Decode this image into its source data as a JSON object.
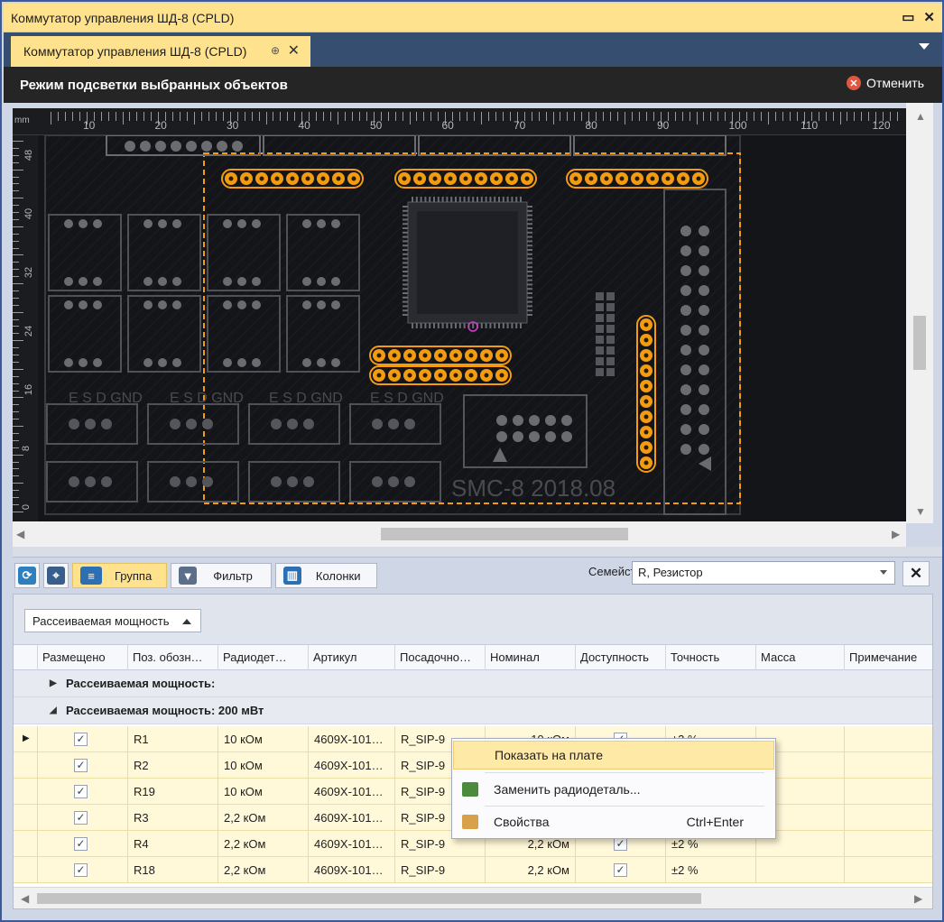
{
  "window": {
    "title": "Коммутатор управления ШД-8 (CPLD)",
    "restore_glyph": "▭",
    "close_glyph": "✕"
  },
  "tab": {
    "label": "Коммутатор управления ШД-8 (CPLD)",
    "pin": "⊕",
    "close": "✕"
  },
  "mode": {
    "text": "Режим подсветки выбранных объектов",
    "cancel_label": "Отменить",
    "cancel_glyph": "✕"
  },
  "ruler": {
    "unit": "mm",
    "top_labels": [
      "10",
      "20",
      "30",
      "40",
      "50",
      "60",
      "70",
      "80",
      "90",
      "100",
      "110",
      "120"
    ],
    "left_labels": [
      "48",
      "40",
      "32",
      "24",
      "16",
      "8",
      "0"
    ]
  },
  "board": {
    "silk_labels": [
      "E S D GND",
      "E S D GND",
      "E S D GND",
      "E S D GND"
    ],
    "marking": "SMC-8  2018.08"
  },
  "toolbar": {
    "group_label": "Группа",
    "filter_label": "Фильтр",
    "columns_label": "Колонки",
    "family_label": "Семейство",
    "family_value": "R, Резистор"
  },
  "grid": {
    "group_by_chip": "Рассеиваемая мощность",
    "columns": [
      "Размещено",
      "Поз. обозн…",
      "Радиодет…",
      "Артикул",
      "Посадочно…",
      "Номинал",
      "Доступность",
      "Точность",
      "Масса",
      "Примечание"
    ],
    "groups": [
      {
        "label": "Рассеиваемая мощность:",
        "expanded": false
      },
      {
        "label": "Рассеиваемая мощность: 200 мВт",
        "expanded": true
      }
    ],
    "rows": [
      {
        "ref": "R1",
        "part": "10 кОм",
        "article": "4609X-101…",
        "footprint": "R_SIP-9",
        "nominal": "10 кОм",
        "accuracy": "±2 %"
      },
      {
        "ref": "R2",
        "part": "10 кОм",
        "article": "4609X-101…",
        "footprint": "R_SIP-9",
        "nominal": "",
        "accuracy": ""
      },
      {
        "ref": "R19",
        "part": "10 кОм",
        "article": "4609X-101…",
        "footprint": "R_SIP-9",
        "nominal": "",
        "accuracy": ""
      },
      {
        "ref": "R3",
        "part": "2,2 кОм",
        "article": "4609X-101…",
        "footprint": "R_SIP-9",
        "nominal": "",
        "accuracy": ""
      },
      {
        "ref": "R4",
        "part": "2,2 кОм",
        "article": "4609X-101…",
        "footprint": "R_SIP-9",
        "nominal": "2,2 кОм",
        "accuracy": "±2 %"
      },
      {
        "ref": "R18",
        "part": "2,2 кОм",
        "article": "4609X-101…",
        "footprint": "R_SIP-9",
        "nominal": "2,2 кОм",
        "accuracy": "±2 %"
      }
    ]
  },
  "context_menu": {
    "show_on_board": "Показать на плате",
    "replace_part": "Заменить радиодеталь...",
    "properties": "Свойства",
    "properties_shortcut": "Ctrl+Enter"
  },
  "colors": {
    "accent": "#ffe28e",
    "highlight": "#f39c12",
    "board_bg": "#121318",
    "tabstrip": "#364e6f"
  }
}
